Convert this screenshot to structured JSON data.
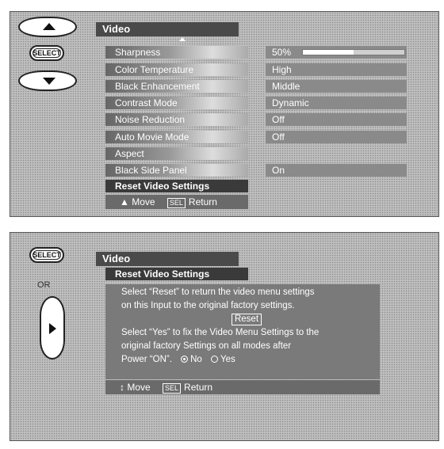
{
  "remote": {
    "select_label": "SELECT",
    "or_label": "OR"
  },
  "panel1": {
    "title": "Video",
    "items": [
      {
        "label": "Sharpness",
        "value": "50%"
      },
      {
        "label": "Color Temperature",
        "value": "High"
      },
      {
        "label": "Black Enhancement",
        "value": "Middle"
      },
      {
        "label": "Contrast Mode",
        "value": "Dynamic"
      },
      {
        "label": "Noise Reduction",
        "value": "Off"
      },
      {
        "label": "Auto Movie Mode",
        "value": "Off"
      },
      {
        "label": "Aspect",
        "value": ""
      },
      {
        "label": "Black Side Panel",
        "value": "On"
      },
      {
        "label": "Reset Video Settings",
        "value": ""
      }
    ],
    "sharpness_level": 0.5,
    "hint_move": "Move",
    "hint_sel": "SEL",
    "hint_return": "Return"
  },
  "panel2": {
    "title": "Video",
    "subtitle": "Reset Video Settings",
    "line1": "Select “Reset” to return the video menu settings",
    "line2": "on this Input to the original factory settings.",
    "reset_label": "Reset",
    "line3": "Select “Yes” to fix the Video Menu Settings to the",
    "line4": "original factory Settings on all modes after",
    "line5": "Power “ON”.",
    "option_no": "No",
    "option_yes": "Yes",
    "hint_move": "Move",
    "hint_sel": "SEL",
    "hint_return": "Return"
  }
}
